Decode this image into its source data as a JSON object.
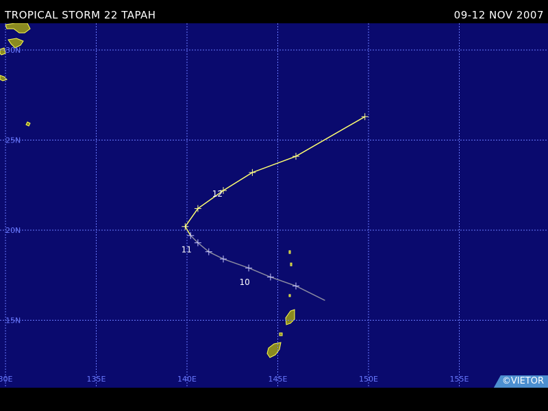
{
  "header": {
    "title": "TROPICAL STORM 22 TAPAH",
    "date_range": "09-12 NOV 2007"
  },
  "credit": "©VIETOR",
  "colors": {
    "ocean": "#0a0a6e",
    "grid": "#6a7aff",
    "land_fill": "#8a8a20",
    "land_edge": "#ffff50",
    "track_storm": "#ffff70",
    "track_depression": "#8a8aa0",
    "credit_bg": "#4c8fd0"
  },
  "map": {
    "lon_min": 130,
    "lon_max": 160,
    "lat_min": 12,
    "lat_max": 32,
    "lon_labels": [
      {
        "lon": 130,
        "label": "30E"
      },
      {
        "lon": 135,
        "label": "135E"
      },
      {
        "lon": 140,
        "label": "140E"
      },
      {
        "lon": 145,
        "label": "145E"
      },
      {
        "lon": 150,
        "label": "150E"
      },
      {
        "lon": 155,
        "label": "155E"
      }
    ],
    "lat_labels": [
      {
        "lat": 30,
        "label": "30N"
      },
      {
        "lat": 25,
        "label": "25N"
      },
      {
        "lat": 20,
        "label": "20N"
      },
      {
        "lat": 15,
        "label": "15N"
      }
    ]
  },
  "track": {
    "depression_points": [
      {
        "lon": 147.6,
        "lat": 16.1
      },
      {
        "lon": 146.0,
        "lat": 16.9
      },
      {
        "lon": 144.6,
        "lat": 17.4
      },
      {
        "lon": 143.4,
        "lat": 17.9
      },
      {
        "lon": 142.0,
        "lat": 18.4
      },
      {
        "lon": 141.2,
        "lat": 18.8
      },
      {
        "lon": 140.6,
        "lat": 19.3
      },
      {
        "lon": 140.2,
        "lat": 19.7
      }
    ],
    "storm_points": [
      {
        "lon": 140.2,
        "lat": 19.7
      },
      {
        "lon": 139.9,
        "lat": 20.2
      },
      {
        "lon": 140.6,
        "lat": 21.2
      },
      {
        "lon": 142.0,
        "lat": 22.2
      },
      {
        "lon": 143.6,
        "lat": 23.2
      },
      {
        "lon": 146.0,
        "lat": 24.1
      },
      {
        "lon": 149.8,
        "lat": 26.3
      }
    ],
    "day_labels": [
      {
        "lon": 143.4,
        "lat": 17.5,
        "label": "10"
      },
      {
        "lon": 140.2,
        "lat": 19.3,
        "label": "11"
      },
      {
        "lon": 141.9,
        "lat": 22.4,
        "label": "12"
      }
    ]
  }
}
